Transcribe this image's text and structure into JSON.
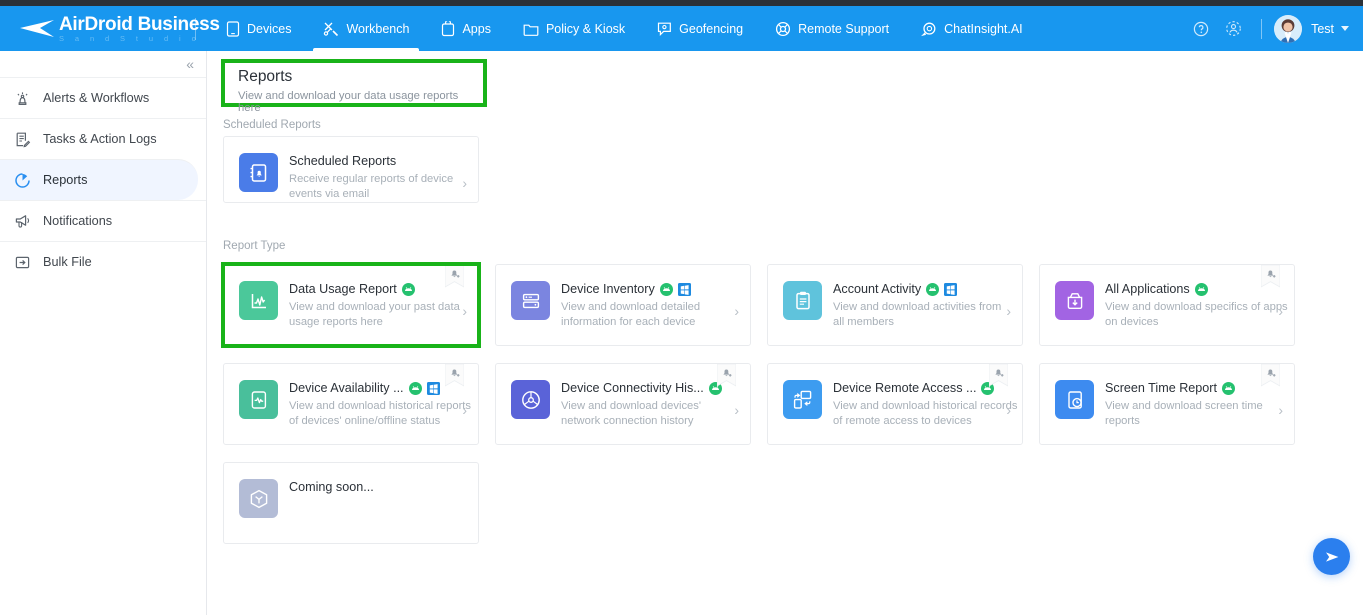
{
  "app": {
    "brand_main": "AirDroid Business",
    "brand_sub": "S a n d   S t u d i o",
    "accent_blue": "#1897ef",
    "highlight_green": "#19b319"
  },
  "topnav": {
    "items": [
      {
        "label": "Devices",
        "icon": "tablet-icon",
        "active": false
      },
      {
        "label": "Workbench",
        "icon": "tools-icon",
        "active": true
      },
      {
        "label": "Apps",
        "icon": "apps-icon",
        "active": false
      },
      {
        "label": "Policy & Kiosk",
        "icon": "folder-icon",
        "active": false
      },
      {
        "label": "Geofencing",
        "icon": "geofence-pin-icon",
        "active": false
      },
      {
        "label": "Remote Support",
        "icon": "lifebuoy-icon",
        "active": false
      },
      {
        "label": "ChatInsight.AI",
        "icon": "chat-ai-icon",
        "active": false
      }
    ],
    "help_icon": "help-circle-icon",
    "account_icon": "user-badge-icon",
    "user_name": "Test",
    "user_caret": "chevron-down-icon"
  },
  "sidebar": {
    "collapse_label": "«",
    "items": [
      {
        "label": "Alerts & Workflows",
        "icon": "alert-beacon-icon",
        "active": false
      },
      {
        "label": "Tasks & Action Logs",
        "icon": "task-list-icon",
        "active": false
      },
      {
        "label": "Reports",
        "icon": "pie-chart-icon",
        "active": true
      },
      {
        "label": "Notifications",
        "icon": "megaphone-icon",
        "active": false
      },
      {
        "label": "Bulk File",
        "icon": "file-transfer-icon",
        "active": false
      }
    ]
  },
  "page": {
    "title": "Reports",
    "subtitle": "View and download your data usage reports here"
  },
  "sections": {
    "scheduled_label": "Scheduled Reports",
    "report_type_label": "Report Type"
  },
  "scheduled_card": {
    "title": "Scheduled Reports",
    "desc": "Receive regular reports of device events via email",
    "icon": "contact-book-bell-icon",
    "tile_color": "#4a7ce8",
    "chevron": "chevron-right-icon"
  },
  "report_cards": [
    {
      "title": "Data Usage Report",
      "desc": "View and download your past data usage reports here",
      "icon": "chart-line-icon",
      "tile_color": "#4bc89a",
      "platforms": [
        "android"
      ],
      "bell": true,
      "highlighted": true
    },
    {
      "title": "Device Inventory",
      "desc": "View and download detailed information for each device",
      "icon": "server-stack-icon",
      "tile_color": "#7b85e0",
      "platforms": [
        "android",
        "windows"
      ],
      "bell": false,
      "highlighted": false
    },
    {
      "title": "Account Activity",
      "desc": "View and download activities from all members",
      "icon": "clipboard-icon",
      "tile_color": "#5fc3dc",
      "platforms": [
        "android",
        "windows"
      ],
      "bell": false,
      "highlighted": false
    },
    {
      "title": "All Applications",
      "desc": "View and download specifics of apps on devices",
      "icon": "app-download-icon",
      "tile_color": "#a264e3",
      "platforms": [
        "android"
      ],
      "bell": true,
      "highlighted": false
    },
    {
      "title": "Device Availability ...",
      "desc": "View and download historical reports of devices' online/offline status",
      "icon": "device-heartbeat-icon",
      "tile_color": "#49bf9b",
      "platforms": [
        "android",
        "windows"
      ],
      "bell": true,
      "highlighted": false
    },
    {
      "title": "Device Connectivity His...",
      "desc": "View and download devices' network connection history",
      "icon": "network-globe-icon",
      "tile_color": "#5a63d8",
      "platforms": [
        "android"
      ],
      "bell": true,
      "highlighted": false
    },
    {
      "title": "Device Remote Access ...",
      "desc": "View and download historical records of remote access to devices",
      "icon": "remote-access-icon",
      "tile_color": "#3d9cf0",
      "platforms": [
        "android"
      ],
      "bell": true,
      "highlighted": false
    },
    {
      "title": "Screen Time Report",
      "desc": "View and download screen time reports",
      "icon": "screen-clock-icon",
      "tile_color": "#3d8bf0",
      "platforms": [
        "android"
      ],
      "bell": true,
      "highlighted": false
    },
    {
      "title": "Coming soon...",
      "desc": "",
      "icon": "cube-box-icon",
      "tile_color": "#b3bcd6",
      "platforms": [],
      "bell": false,
      "highlighted": false
    }
  ],
  "fab": {
    "icon": "paper-plane-icon",
    "color": "#2b7fee"
  }
}
